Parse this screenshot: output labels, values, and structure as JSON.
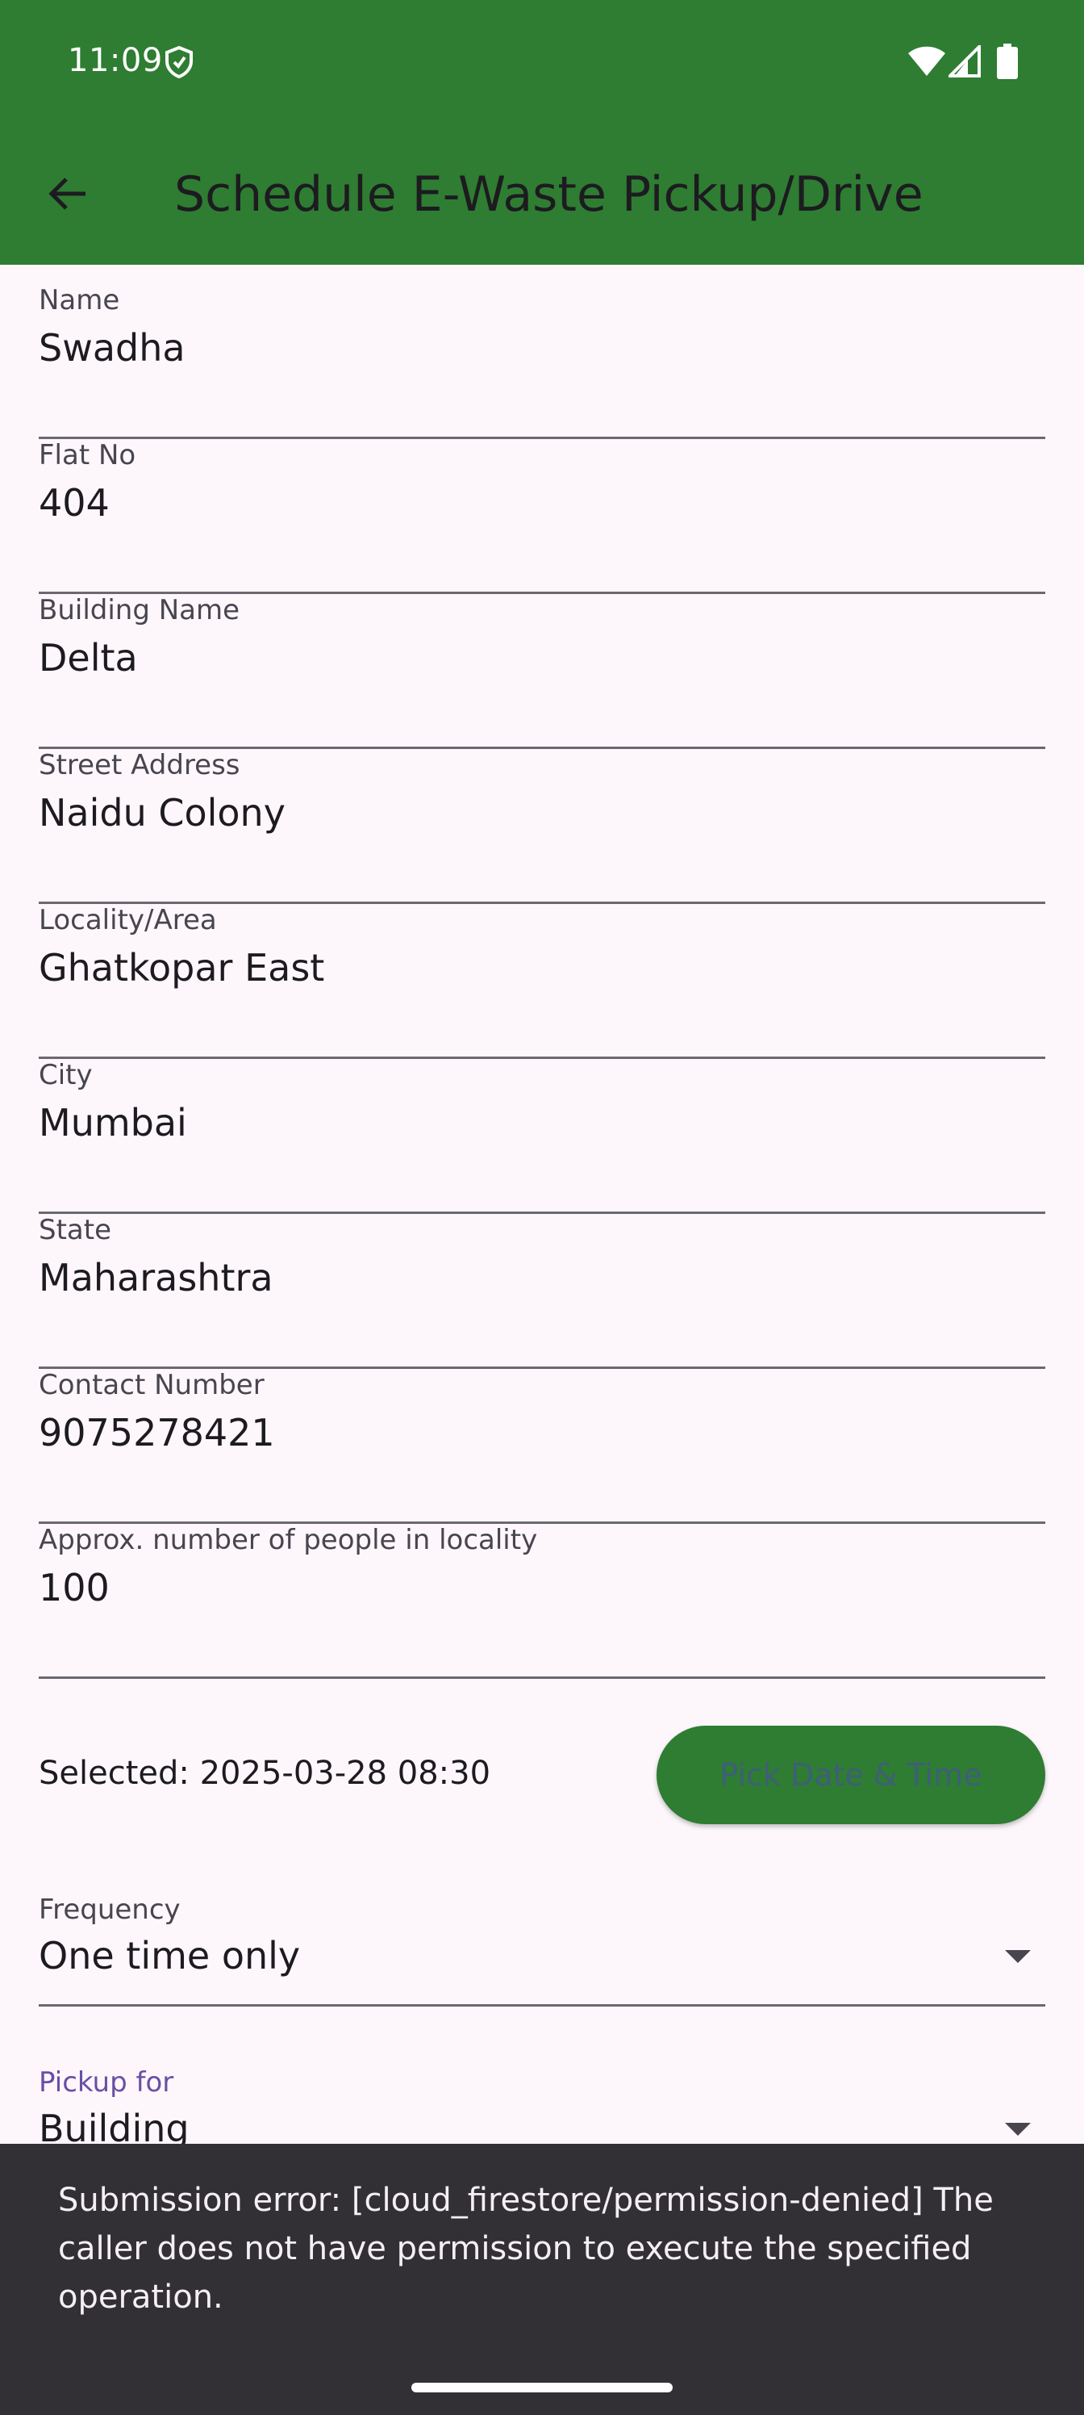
{
  "status_bar": {
    "time": "11:09",
    "icons": [
      "shield-icon",
      "wifi-icon",
      "signal-icon",
      "battery-icon"
    ]
  },
  "app_bar": {
    "title": "Schedule E-Waste Pickup/Drive",
    "back_icon": "arrow-back-icon",
    "background_color": "#2e7d32"
  },
  "form": {
    "fields": [
      {
        "label": "Name",
        "value": "Swadha"
      },
      {
        "label": "Flat No",
        "value": "404"
      },
      {
        "label": "Building Name",
        "value": "Delta"
      },
      {
        "label": "Street Address",
        "value": "Naidu Colony"
      },
      {
        "label": "Locality/Area",
        "value": "Ghatkopar East"
      },
      {
        "label": "City",
        "value": "Mumbai"
      },
      {
        "label": "State",
        "value": "Maharashtra"
      },
      {
        "label": "Contact Number",
        "value": "9075278421"
      },
      {
        "label": "Approx. number of people in locality",
        "value": "100"
      }
    ],
    "datetime": {
      "selected_text": "Selected: 2025-03-28 08:30",
      "button_label": "Pick Date & Time"
    },
    "frequency": {
      "label": "Frequency",
      "value": "One time only"
    },
    "pickup_for": {
      "label": "Pickup for",
      "value": "Building"
    }
  },
  "snackbar": {
    "message": "Submission error: [cloud_firestore/permission-denied] The caller does not have permission to execute the specified operation."
  }
}
